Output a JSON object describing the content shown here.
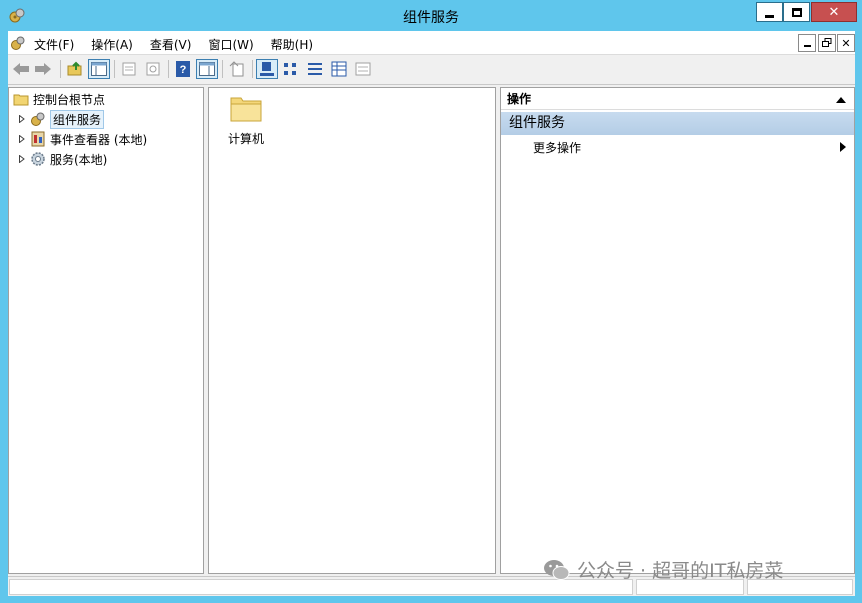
{
  "window": {
    "title": "组件服务"
  },
  "menu": {
    "items": [
      "文件(F)",
      "操作(A)",
      "查看(V)",
      "窗口(W)",
      "帮助(H)"
    ]
  },
  "tree": {
    "root": "控制台根节点",
    "children": [
      {
        "label": "组件服务",
        "selected": true,
        "icon": "component-services-icon"
      },
      {
        "label": "事件查看器 (本地)",
        "icon": "event-viewer-icon"
      },
      {
        "label": "服务(本地)",
        "icon": "services-gear-icon"
      }
    ]
  },
  "main": {
    "items": [
      {
        "label": "计算机",
        "icon": "folder-icon"
      }
    ]
  },
  "actions": {
    "header": "操作",
    "group": "组件服务",
    "items": [
      {
        "label": "更多操作"
      }
    ]
  },
  "watermark": {
    "text": "公众号 · 超哥的IT私房菜"
  },
  "colors": {
    "title_bar": "#5fc6ec",
    "close_button": "#c75050",
    "actions_group": "#b4cde6"
  }
}
